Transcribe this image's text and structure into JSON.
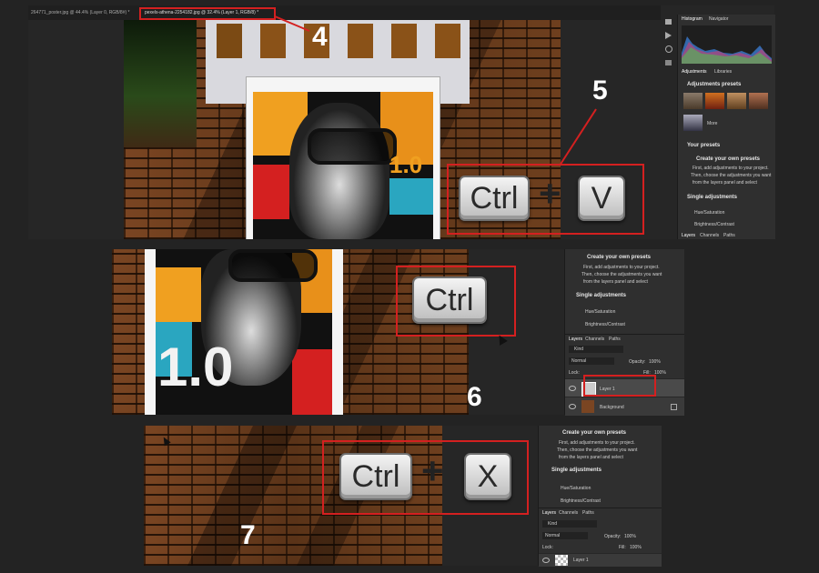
{
  "panel1": {
    "doc_tabs": [
      "264771_poster.jpg @ 44.4% (Layer 0, RGB/8#) *",
      "pexels-athena-2254182.jpg @ 32.4% (Layer 1, RGB/8) *"
    ],
    "histogram_tab": "Histogram",
    "navigator_tab": "Navigator",
    "adjustments_tab": "Adjustments",
    "libraries_tab": "Libraries",
    "adjustment_presets": "Adjustments presets",
    "more_label": "More",
    "your_presets": "Your presets",
    "create_title": "Create your own presets",
    "create_desc1": "First, add adjustments to your project.",
    "create_desc2": "Then, choose the adjustments you want",
    "create_desc3": "from the layers panel and select",
    "single_adjustments": "Single adjustments",
    "hue_saturation": "Hue/Saturation",
    "brightness_contrast": "Brightness/Contrast",
    "bottom_tabs": [
      "Layers",
      "Channels",
      "Paths"
    ],
    "step": "4",
    "shortcut_step": "5",
    "keys": [
      "Ctrl",
      "+",
      "V"
    ]
  },
  "panel2": {
    "create_title": "Create your own presets",
    "create_desc1": "First, add adjustments to your project.",
    "create_desc2": "Then, choose the adjustments you want",
    "create_desc3": "from the layers panel and select",
    "single_adjustments": "Single adjustments",
    "hue_saturation": "Hue/Saturation",
    "brightness_contrast": "Brightness/Contrast",
    "tabs": [
      "Layers",
      "Channels",
      "Paths"
    ],
    "kind": "Kind",
    "blend_mode": "Normal",
    "opacity_label": "Opacity:",
    "opacity_value": "100%",
    "lock_label": "Lock:",
    "fill_label": "Fill:",
    "fill_value": "100%",
    "layers": [
      "Layer 1",
      "Background"
    ],
    "key": "Ctrl",
    "step": "6"
  },
  "panel3": {
    "create_title": "Create your own presets",
    "create_desc1": "First, add adjustments to your project.",
    "create_desc2": "Then, choose the adjustments you want",
    "create_desc3": "from the layers panel and select",
    "single_adjustments": "Single adjustments",
    "hue_saturation": "Hue/Saturation",
    "brightness_contrast": "Brightness/Contrast",
    "tabs": [
      "Layers",
      "Channels",
      "Paths"
    ],
    "kind": "Kind",
    "blend_mode": "Normal",
    "opacity_label": "Opacity:",
    "opacity_value": "100%",
    "lock_label": "Lock:",
    "fill_label": "Fill:",
    "fill_value": "100%",
    "layers": [
      "Layer 1"
    ],
    "keys": [
      "Ctrl",
      "+",
      "X"
    ],
    "step": "7"
  },
  "poster_text": "1.0",
  "colors": {
    "annotation_red": "#d42020",
    "panel_bg": "#2f2f2f"
  }
}
